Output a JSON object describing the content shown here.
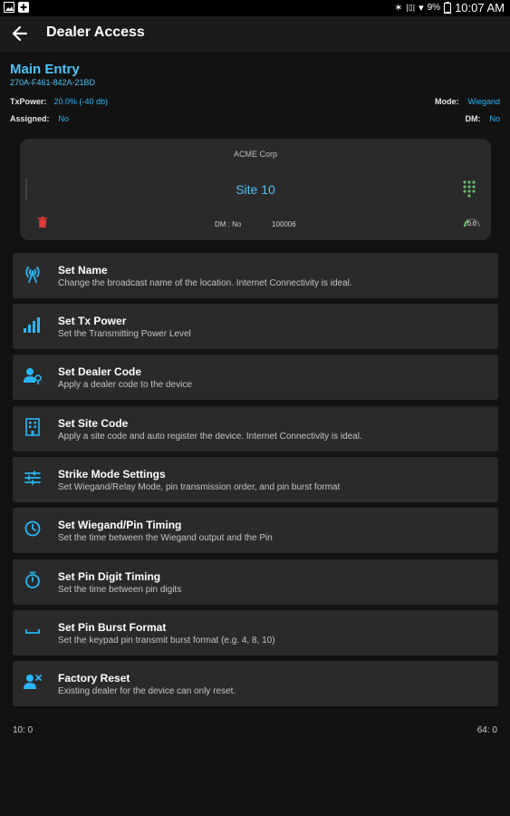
{
  "status_bar": {
    "battery": "9%",
    "time": "10:07 AM"
  },
  "app_bar": {
    "title": "Dealer Access"
  },
  "device": {
    "name": "Main Entry",
    "id": "270A-F461-842A-21BD",
    "txpower_label": "TxPower:",
    "txpower_value": "20.0% (-40 db)",
    "assigned_label": "Assigned:",
    "assigned_value": "No",
    "mode_label": "Mode:",
    "mode_value": "Wiegand",
    "dm_label": "DM:",
    "dm_value": "No"
  },
  "site_card": {
    "company": "ACME Corp",
    "site_name": "Site 10",
    "dm_text": "DM : No",
    "code": "100006",
    "gauge_value": "0.0"
  },
  "menu": [
    {
      "icon": "broadcast-icon",
      "title": "Set Name",
      "subtitle": "Change the broadcast name of the location. Internet Connectivity is ideal."
    },
    {
      "icon": "signal-bars-icon",
      "title": "Set Tx Power",
      "subtitle": "Set the Transmitting Power Level"
    },
    {
      "icon": "person-key-icon",
      "title": "Set Dealer Code",
      "subtitle": "Apply a dealer code to the device"
    },
    {
      "icon": "building-icon",
      "title": "Set Site Code",
      "subtitle": "Apply a site code and auto register the device. Internet Connectivity is ideal."
    },
    {
      "icon": "sliders-icon",
      "title": "Strike Mode Settings",
      "subtitle": "Set Wiegand/Relay Mode, pin transmission order, and pin burst format"
    },
    {
      "icon": "clock-icon",
      "title": "Set Wiegand/Pin Timing",
      "subtitle": "Set the time between the Wiegand output and the Pin"
    },
    {
      "icon": "stopwatch-icon",
      "title": "Set Pin Digit Timing",
      "subtitle": "Set the time between pin digits"
    },
    {
      "icon": "space-bar-icon",
      "title": "Set Pin Burst Format",
      "subtitle": "Set the keypad pin transmit burst format (e.g. 4, 8, 10)"
    },
    {
      "icon": "person-remove-icon",
      "title": "Factory Reset",
      "subtitle": "Existing dealer for the device can only reset."
    }
  ],
  "footer": {
    "left": "10: 0",
    "right": "64: 0"
  },
  "colors": {
    "accent": "#4fc3f7",
    "accent_dark": "#29b6f6",
    "keypad": "#66bb6a",
    "trash": "#e53935",
    "card": "#2a2a2a",
    "background": "#121212"
  }
}
